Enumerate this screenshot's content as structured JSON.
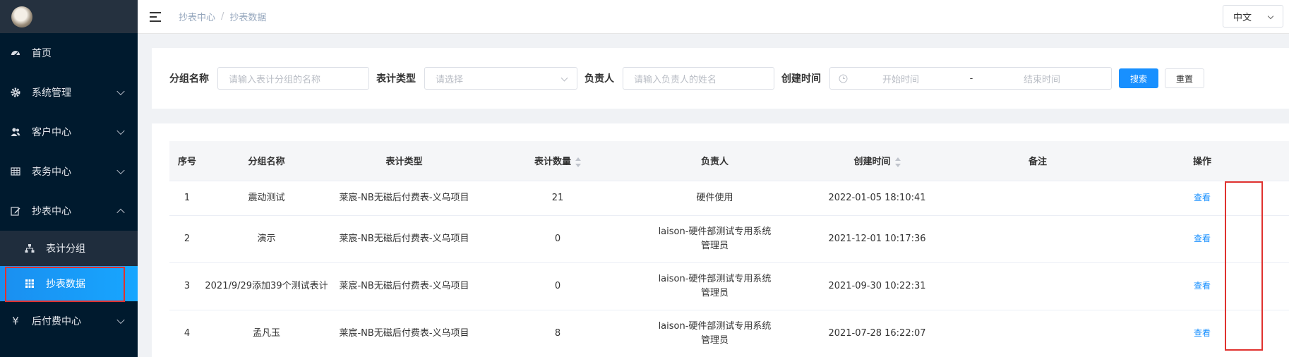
{
  "sidebar": {
    "items": [
      {
        "label": "首页",
        "icon": "dashboard-icon"
      },
      {
        "label": "系统管理",
        "icon": "gear-icon"
      },
      {
        "label": "客户中心",
        "icon": "users-icon"
      },
      {
        "label": "表务中心",
        "icon": "table-icon"
      },
      {
        "label": "抄表中心",
        "icon": "edit-icon"
      }
    ],
    "submenu": [
      {
        "label": "表计分组",
        "icon": "sitemap-icon"
      },
      {
        "label": "抄表数据",
        "icon": "grid-icon"
      }
    ],
    "after": [
      {
        "label": "后付费中心",
        "icon": "yen-icon"
      }
    ]
  },
  "header": {
    "breadcrumb": [
      "抄表中心",
      "抄表数据"
    ],
    "breadcrumb_sep": "/",
    "lang": "中文"
  },
  "search": {
    "group_label": "分组名称",
    "group_placeholder": "请输入表计分组的名称",
    "type_label": "表计类型",
    "type_placeholder": "请选择",
    "owner_label": "负责人",
    "owner_placeholder": "请输入负责人的姓名",
    "time_label": "创建时间",
    "start_placeholder": "开始时间",
    "range_sep": "-",
    "end_placeholder": "结束时间",
    "search_btn": "搜索",
    "reset_btn": "重置"
  },
  "table": {
    "headers": [
      "序号",
      "分组名称",
      "表计类型",
      "表计数量",
      "负责人",
      "创建时间",
      "备注",
      "操作"
    ],
    "rows": [
      {
        "no": "1",
        "name": "震动测试",
        "type": "莱宸-NB无磁后付费表-义乌项目",
        "count": "21",
        "owner": "硬件使用",
        "created": "2022-01-05 18:10:41",
        "remark": "",
        "action": "查看"
      },
      {
        "no": "2",
        "name": "演示",
        "type": "莱宸-NB无磁后付费表-义乌项目",
        "count": "0",
        "owner": "laison-硬件部测试专用系统管理员",
        "created": "2021-12-01 10:17:36",
        "remark": "",
        "action": "查看"
      },
      {
        "no": "3",
        "name": "2021/9/29添加39个测试表计",
        "type": "莱宸-NB无磁后付费表-义乌项目",
        "count": "0",
        "owner": "laison-硬件部测试专用系统管理员",
        "created": "2021-09-30 10:22:31",
        "remark": "",
        "action": "查看"
      },
      {
        "no": "4",
        "name": "孟凡玉",
        "type": "莱宸-NB无磁后付费表-义乌项目",
        "count": "8",
        "owner": "laison-硬件部测试专用系统管理员",
        "created": "2021-07-28 16:22:07",
        "remark": "",
        "action": "查看"
      }
    ]
  }
}
